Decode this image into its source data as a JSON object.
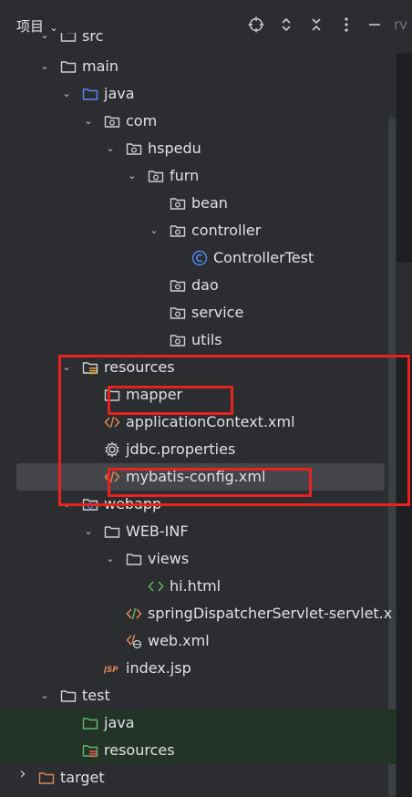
{
  "header": {
    "title": "项目",
    "hint": "rv"
  },
  "tree": [
    {
      "label": "src",
      "indent": 66,
      "arrow": "down",
      "icon": "folder"
    },
    {
      "label": "main",
      "indent": 66,
      "arrow": "down",
      "icon": "folder"
    },
    {
      "label": "java",
      "indent": 90,
      "arrow": "down",
      "icon": "source-folder"
    },
    {
      "label": "com",
      "indent": 114,
      "arrow": "down",
      "icon": "package"
    },
    {
      "label": "hspedu",
      "indent": 138,
      "arrow": "down",
      "icon": "package"
    },
    {
      "label": "furn",
      "indent": 162,
      "arrow": "down",
      "icon": "package"
    },
    {
      "label": "bean",
      "indent": 186,
      "arrow": "none",
      "icon": "package"
    },
    {
      "label": "controller",
      "indent": 186,
      "arrow": "down",
      "icon": "package"
    },
    {
      "label": "ControllerTest",
      "indent": 210,
      "arrow": "none",
      "icon": "class"
    },
    {
      "label": "dao",
      "indent": 186,
      "arrow": "none",
      "icon": "package"
    },
    {
      "label": "service",
      "indent": 186,
      "arrow": "none",
      "icon": "package"
    },
    {
      "label": "utils",
      "indent": 186,
      "arrow": "none",
      "icon": "package"
    },
    {
      "label": "resources",
      "indent": 90,
      "arrow": "down",
      "icon": "resources-folder"
    },
    {
      "label": "mapper",
      "indent": 114,
      "arrow": "none",
      "icon": "folder"
    },
    {
      "label": "applicationContext.xml",
      "indent": 114,
      "arrow": "none",
      "icon": "xml"
    },
    {
      "label": "jdbc.properties",
      "indent": 114,
      "arrow": "none",
      "icon": "properties"
    },
    {
      "label": "mybatis-config.xml",
      "indent": 114,
      "arrow": "none",
      "icon": "xml",
      "selected": true
    },
    {
      "label": "webapp",
      "indent": 90,
      "arrow": "down",
      "icon": "web-folder"
    },
    {
      "label": "WEB-INF",
      "indent": 114,
      "arrow": "down",
      "icon": "folder"
    },
    {
      "label": "views",
      "indent": 138,
      "arrow": "down",
      "icon": "folder"
    },
    {
      "label": "hi.html",
      "indent": 162,
      "arrow": "none",
      "icon": "html"
    },
    {
      "label": "springDispatcherServlet-servlet.x",
      "indent": 138,
      "arrow": "none",
      "icon": "spring-xml"
    },
    {
      "label": "web.xml",
      "indent": 138,
      "arrow": "none",
      "icon": "web-xml"
    },
    {
      "label": "index.jsp",
      "indent": 114,
      "arrow": "none",
      "icon": "jsp"
    },
    {
      "label": "test",
      "indent": 66,
      "arrow": "down",
      "icon": "folder"
    },
    {
      "label": "java",
      "indent": 90,
      "arrow": "none",
      "icon": "test-folder",
      "green": true
    },
    {
      "label": "resources",
      "indent": 90,
      "arrow": "none",
      "icon": "test-resources-folder",
      "green": true
    },
    {
      "label": "target",
      "indent": 42,
      "arrow": "right",
      "icon": "excluded-folder"
    }
  ],
  "colors": {
    "highlight": "#e8231f",
    "folder": "#ced0d6",
    "source_folder": "#548af7",
    "test_folder": "#5fb865",
    "excluded_folder": "#e08855",
    "xml": "#e08855",
    "html": "#5fb865",
    "class": "#548af7",
    "selection": "#43454a"
  }
}
